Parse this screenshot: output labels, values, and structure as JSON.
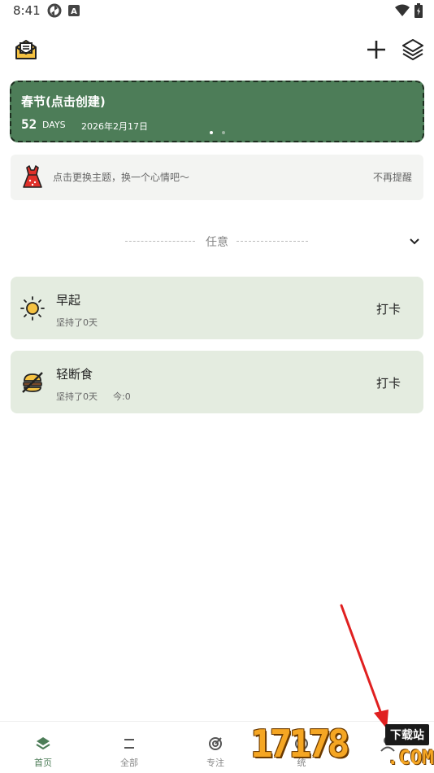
{
  "status_bar": {
    "time": "8:41",
    "icons": [
      "sync-icon",
      "a-badge-icon",
      "wifi-icon",
      "battery-icon"
    ]
  },
  "toolbar": {
    "left_icon": "mail-open-icon",
    "add_icon": "plus-icon",
    "layers_icon": "layers-icon"
  },
  "countdown": {
    "title": "春节(点击创建)",
    "days": "52",
    "unit": "DAYS",
    "date": "2026年2月17日",
    "bg_color": "#4d7d58",
    "page_count": 2,
    "active_page": 1
  },
  "theme_tip": {
    "icon": "dress-icon",
    "text": "点击更换主题，换一个心情吧～",
    "dismiss": "不再提醒"
  },
  "category": {
    "label": "任意"
  },
  "habits": [
    {
      "name": "早起",
      "icon": "sun-icon",
      "streak": "坚持了0天",
      "today": "",
      "action": "打卡"
    },
    {
      "name": "轻断食",
      "icon": "burger-off-icon",
      "streak": "坚持了0天",
      "today": "今:0",
      "action": "打卡"
    }
  ],
  "bottom_nav": {
    "items": [
      {
        "label": "首页",
        "icon": "home-stack-icon",
        "active": true
      },
      {
        "label": "全部",
        "icon": "list-icon",
        "active": false
      },
      {
        "label": "专注",
        "icon": "target-icon",
        "active": false
      },
      {
        "label": "统",
        "icon": "chart-icon",
        "active": false
      },
      {
        "label": "",
        "icon": "profile-icon",
        "active": false
      }
    ],
    "accent_color": "#4d7d58"
  },
  "watermark": {
    "digits": "17178",
    "tag": "下载站",
    "suffix": ".COM"
  }
}
